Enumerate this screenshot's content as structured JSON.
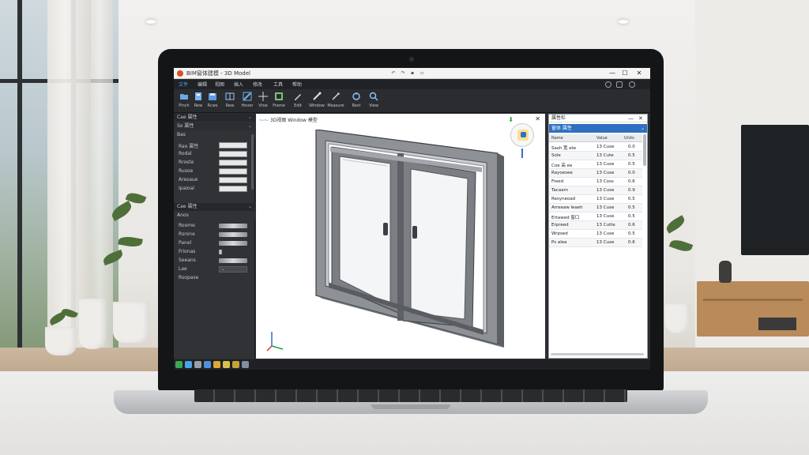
{
  "app": {
    "title": "BIM窗体建模 - 3D Model",
    "window_controls": [
      "—",
      "☐",
      "✕"
    ]
  },
  "menu": {
    "items": [
      "文件",
      "编辑",
      "视图",
      "插入",
      "修改",
      "工具",
      "帮助"
    ],
    "active_index": 0
  },
  "ribbon": {
    "tools": [
      {
        "label": "Pinch",
        "icon": "folder-icon"
      },
      {
        "label": "Rew",
        "icon": "new-icon"
      },
      {
        "label": "Rcws",
        "icon": "save-icon"
      },
      {
        "label": "Rew",
        "icon": "wall-icon"
      },
      {
        "label": "Hover",
        "icon": "line-icon"
      },
      {
        "label": "Vtoe",
        "icon": "crosshair-icon"
      },
      {
        "label": "Frame",
        "icon": "frame-icon"
      },
      {
        "label": "Edit",
        "icon": "pencil-icon"
      },
      {
        "label": "Window",
        "icon": "window-icon"
      },
      {
        "label": "Measure",
        "icon": "measure-icon"
      },
      {
        "label": "Rest",
        "icon": "reset-icon"
      },
      {
        "label": "View",
        "icon": "zoom-icon"
      }
    ]
  },
  "left_panel": {
    "section1_title": "Cae 属性",
    "section1_sub": "So 属性",
    "group_label": "Bas",
    "props": [
      {
        "key": "Rao 属性",
        "value": ""
      },
      {
        "key": "Rodal",
        "value": ""
      },
      {
        "key": "Rroste",
        "value": ""
      },
      {
        "key": "Rusoe",
        "value": ""
      },
      {
        "key": "Aresaue",
        "value": ""
      },
      {
        "key": "Ipaioal",
        "value": ""
      }
    ],
    "section2_title": "Cae 属性",
    "mat_label": "Anos",
    "materials": [
      {
        "key": "Roome",
        "kind": "swatch"
      },
      {
        "key": "Rsrone",
        "kind": "swatch"
      },
      {
        "key": "Panel",
        "kind": "swatch"
      },
      {
        "key": "Frionas",
        "kind": "small"
      },
      {
        "key": "Seeans",
        "kind": "swatch"
      },
      {
        "key": "Lae",
        "kind": "select"
      },
      {
        "key": "Rsopase",
        "kind": "none"
      }
    ]
  },
  "viewport": {
    "title": "3D视图 Window 模型",
    "close": "✕"
  },
  "right_panel": {
    "title": "属性栏",
    "tab": "窗体 属性",
    "columns": [
      "Name",
      "Value",
      "Units"
    ],
    "rows": [
      [
        "Sash 宽 ete",
        "13 Cuse",
        "0.0"
      ],
      [
        "Sole",
        "13 Cute",
        "0.5"
      ],
      [
        "Coe 高 ee",
        "13 Cuse",
        "0.5"
      ],
      [
        "Rayoesee",
        "13 Cuse",
        "0.0"
      ],
      [
        "Freed",
        "13 Coss",
        "0.6"
      ],
      [
        "Tacaam",
        "13 Cuse",
        "0.9"
      ],
      [
        "Resyneoad",
        "13 Cuse",
        "0.5"
      ],
      [
        "Arreeaw leaeh",
        "13 Cuse",
        "0.5"
      ],
      [
        "Ertawed 窗口",
        "13 Cuse",
        "0.5"
      ],
      [
        "Erpreed",
        "13 Cutte",
        "0.6"
      ],
      [
        "Wrpsed",
        "13 Cuse",
        "0.5"
      ],
      [
        "Ps alea",
        "13 Cuse",
        "0.6"
      ]
    ]
  },
  "status_icons": [
    "grid-icon",
    "snap-icon",
    "ortho-icon",
    "polar-icon",
    "object-icon",
    "layer-icon",
    "lock-icon",
    "display-icon",
    "settings-icon"
  ],
  "colors": {
    "accent": "#2f6fc0",
    "app_dark": "#2b2d30",
    "viewport_bg": "#ffffff"
  }
}
